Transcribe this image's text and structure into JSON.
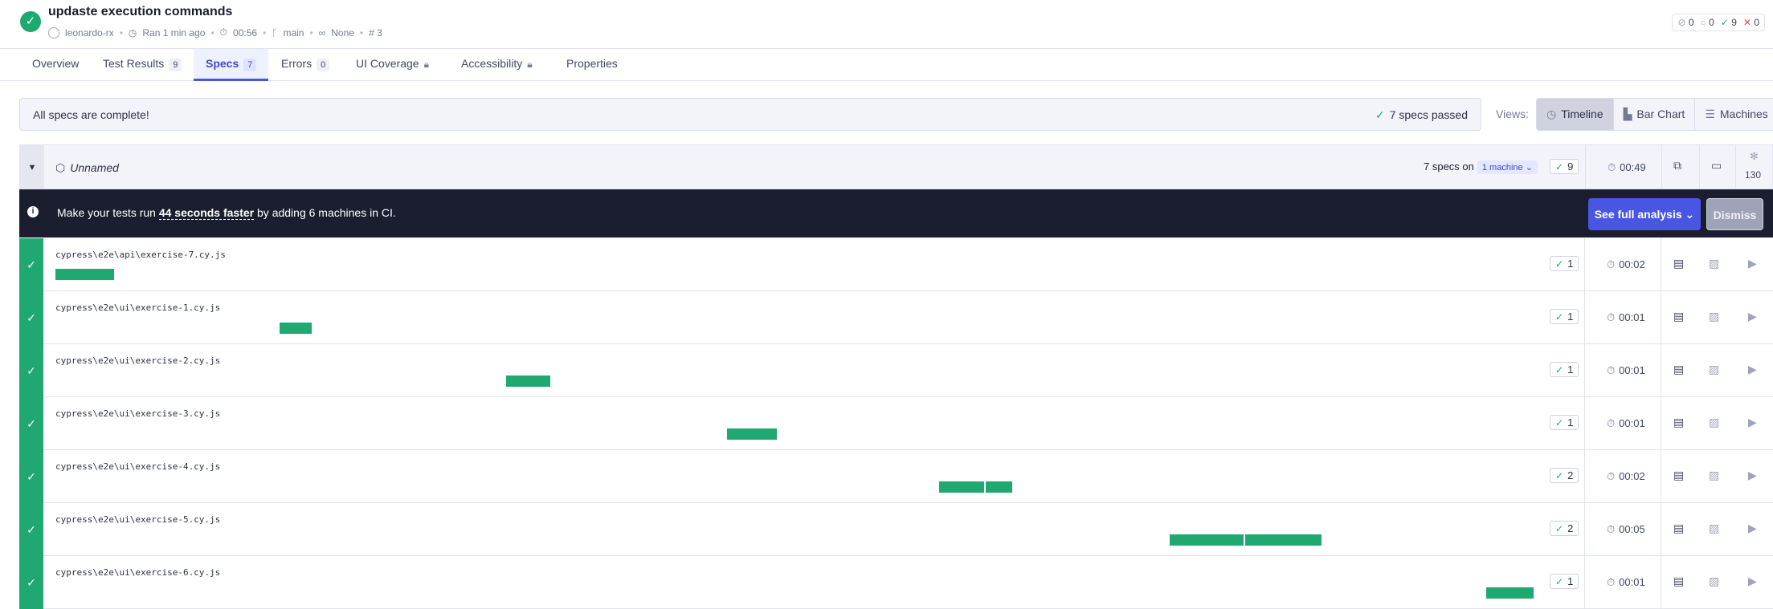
{
  "header": {
    "title": "updaste execution commands",
    "author": "leonardo-rx",
    "ran": "Ran 1 min ago",
    "duration": "00:56",
    "branch": "main",
    "flaky": "None",
    "run_number": "# 3",
    "counts": {
      "skipped": "0",
      "pending": "0",
      "passed": "9",
      "failed": "0"
    }
  },
  "tabs": [
    {
      "label": "Overview"
    },
    {
      "label": "Test Results",
      "badge": "9"
    },
    {
      "label": "Specs",
      "badge": "7"
    },
    {
      "label": "Errors",
      "badge": "0"
    },
    {
      "label": "UI Coverage"
    },
    {
      "label": "Accessibility"
    },
    {
      "label": "Properties"
    }
  ],
  "banner": {
    "message": "All specs are complete!",
    "passed": "7 specs passed"
  },
  "views": {
    "label": "Views:",
    "options": [
      "Timeline",
      "Bar Chart",
      "Machines"
    ],
    "selected": "Timeline"
  },
  "group": {
    "name": "Unnamed",
    "specs_text": "7 specs on",
    "machines": "1 machine",
    "passed": "9",
    "duration": "00:49",
    "concurrency": "130"
  },
  "promo": {
    "prefix": "Make your tests run ",
    "highlight": "44 seconds faster",
    "suffix": " by adding 6 machines in CI.",
    "cta": "See full analysis",
    "dismiss": "Dismiss"
  },
  "specs": [
    {
      "name": "cypress\\e2e\\api\\exercise-7.cy.js",
      "passed": "1",
      "duration": "00:02",
      "segments": [
        [
          0,
          2
        ]
      ]
    },
    {
      "name": "cypress\\e2e\\ui\\exercise-1.cy.js",
      "passed": "1",
      "duration": "00:01",
      "segments": [
        [
          7.6,
          8.7
        ]
      ]
    },
    {
      "name": "cypress\\e2e\\ui\\exercise-2.cy.js",
      "passed": "1",
      "duration": "00:01",
      "segments": [
        [
          15.3,
          16.8
        ]
      ]
    },
    {
      "name": "cypress\\e2e\\ui\\exercise-3.cy.js",
      "passed": "1",
      "duration": "00:01",
      "segments": [
        [
          22.8,
          24.5
        ]
      ]
    },
    {
      "name": "cypress\\e2e\\ui\\exercise-4.cy.js",
      "passed": "2",
      "duration": "00:02",
      "segments": [
        [
          30.0,
          31.55
        ],
        [
          31.6,
          32.5
        ]
      ]
    },
    {
      "name": "cypress\\e2e\\ui\\exercise-5.cy.js",
      "passed": "2",
      "duration": "00:05",
      "segments": [
        [
          37.85,
          40.35
        ],
        [
          40.4,
          43.0
        ]
      ]
    },
    {
      "name": "cypress\\e2e\\ui\\exercise-6.cy.js",
      "passed": "1",
      "duration": "00:01",
      "segments": [
        [
          48.6,
          50.2
        ]
      ]
    }
  ],
  "timeline": {
    "max_seconds": 50.2
  },
  "colors": {
    "passed": "#1fa971",
    "accent": "#4956e3"
  }
}
